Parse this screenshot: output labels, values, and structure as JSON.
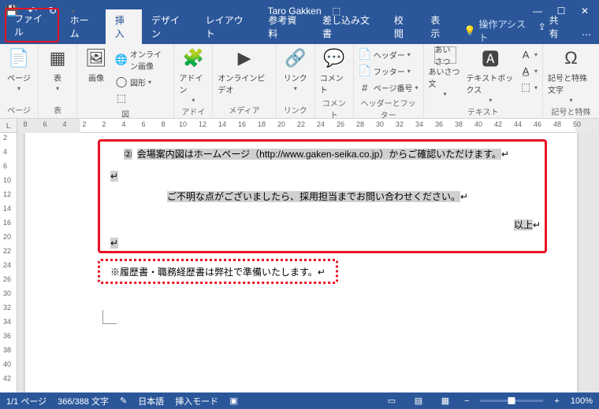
{
  "titlebar": {
    "username": "Taro Gakken"
  },
  "tabs": {
    "file": "ファイル",
    "home": "ホーム",
    "insert": "挿入",
    "design": "デザイン",
    "layout": "レイアウト",
    "references": "参考資料",
    "mailings": "差し込み文書",
    "review": "校閲",
    "view": "表示",
    "tell": "操作アシスト",
    "share": "共有"
  },
  "ribbon": {
    "pages": {
      "label": "ページ",
      "page": "ページ"
    },
    "tables": {
      "label": "表",
      "table": "表"
    },
    "illustrations": {
      "label": "図",
      "image": "画像",
      "online_images": "オンライン画像",
      "shapes": "図形"
    },
    "addins": {
      "label": "アドイン",
      "addins": "アドイン"
    },
    "media": {
      "label": "メディア",
      "online_video": "オンラインビデオ"
    },
    "links": {
      "label": "リンク",
      "link": "リンク"
    },
    "comments": {
      "label": "コメント",
      "comment": "コメント"
    },
    "headerfooter": {
      "label": "ヘッダーとフッター",
      "header": "ヘッダー",
      "footer": "フッター",
      "page_number": "ページ番号"
    },
    "text": {
      "label": "テキスト",
      "greeting": "あいさつ文",
      "textbox": "テキストボックス"
    },
    "symbols": {
      "label": "記号と特殊文字",
      "symbol": "記号と特殊文字"
    }
  },
  "document": {
    "line1_num": "②",
    "line1": "会場案内図はホームページ（http://www.gaken-seika.co.jp）からご確認いただけます。",
    "line2": "ご不明な点がございましたら、採用担当までお問い合わせください。",
    "line3": "以上",
    "line4": "※履歴書・職務経歴書は弊社で準備いたします。"
  },
  "statusbar": {
    "page": "1/1 ページ",
    "words": "366/388 文字",
    "language": "日本語",
    "mode": "挿入モード",
    "zoom": "100%"
  },
  "ruler_h": [
    "8",
    "6",
    "4",
    "2",
    "2",
    "4",
    "6",
    "8",
    "10",
    "12",
    "14",
    "16",
    "18",
    "20",
    "22",
    "24",
    "26",
    "28",
    "30",
    "32",
    "34",
    "36",
    "38",
    "40",
    "42",
    "44",
    "46",
    "48",
    "50"
  ],
  "ruler_v": [
    "2",
    "4",
    "6",
    "10",
    "12",
    "14",
    "16",
    "20",
    "22",
    "24",
    "26",
    "30",
    "32",
    "34",
    "36",
    "38",
    "40",
    "42"
  ]
}
